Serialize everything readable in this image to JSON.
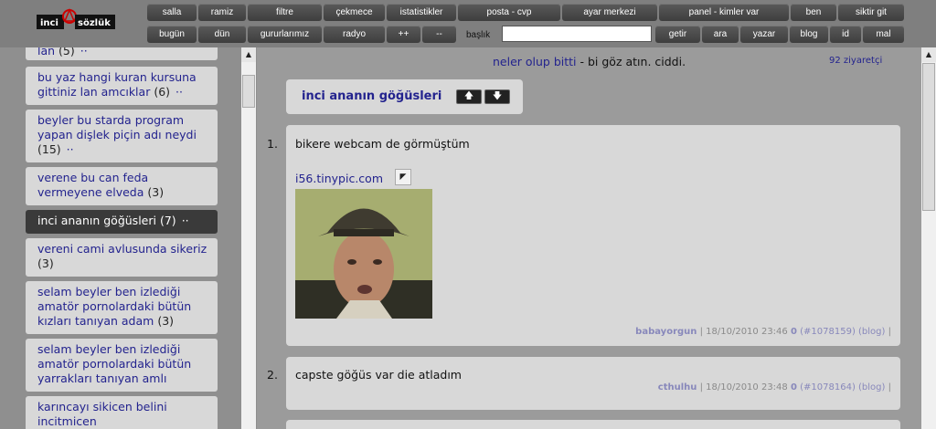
{
  "nav": {
    "row1": [
      "salla",
      "ramiz",
      "filtre",
      "çekmece",
      "istatistikler",
      "posta   -   cvp",
      "ayar merkezi",
      "panel   -   kimler var",
      "ben",
      "siktir git"
    ],
    "row2": [
      "bugün",
      "dün",
      "gururlarımız",
      "radyo",
      "++",
      "--",
      "getir",
      "ara",
      "yazar",
      "blog",
      "id",
      "mal"
    ],
    "search_label": "başlık",
    "search_value": ""
  },
  "sidebar": {
    "items": [
      {
        "title": "lan",
        "count": "(5)",
        "dots": "··"
      },
      {
        "title": "bu yaz hangi kuran kursuna gittiniz lan amcıklar",
        "count": "(6)",
        "dots": "··"
      },
      {
        "title": "beyler bu starda program yapan dişlek piçin adı neydi",
        "count": "(15)",
        "dots": "··"
      },
      {
        "title": "verene bu can feda vermeyene elveda",
        "count": "(3)",
        "dots": ""
      },
      {
        "title": "inci ananın göğüsleri",
        "count": "(7)",
        "dots": "··"
      },
      {
        "title": "vereni cami avlusunda sikeriz",
        "count": "(3)",
        "dots": ""
      },
      {
        "title": "selam beyler ben izlediği amatör pornolardaki bütün kızları tanıyan adam",
        "count": "(3)",
        "dots": ""
      },
      {
        "title": "selam beyler ben izlediği amatör pornolardaki bütün yarrakları tanıyan amlı",
        "count": "",
        "dots": ""
      },
      {
        "title": "karıncayı sikicen belini incitmicen",
        "count": "",
        "dots": ""
      }
    ]
  },
  "main": {
    "topline_link": "neler olup bitti",
    "topline_rest": " - bi göz atın. ciddi.",
    "visitors": "92 ziyaretçi",
    "title": "inci ananın göğüsleri",
    "up_icon": "up-arrow-icon",
    "down_icon": "down-arrow-icon",
    "entries": [
      {
        "num": "1.",
        "text": "bikere webcam de görmüştüm",
        "link": "i56.tinypic.com",
        "author": "babayorgun",
        "date": "18/10/2010 23:46",
        "score": "0",
        "id": "(#1078159)",
        "blog": "(blog)"
      },
      {
        "num": "2.",
        "text": "capste göğüs var die atladım",
        "link": "",
        "author": "cthulhu",
        "date": "18/10/2010 23:48",
        "score": "0",
        "id": "(#1078164)",
        "blog": "(blog)"
      }
    ]
  },
  "colors": {
    "link": "#23238e",
    "panel": "#d8d8d8",
    "active": "#3a3a3a",
    "nav_button": "#4a4a4a"
  }
}
